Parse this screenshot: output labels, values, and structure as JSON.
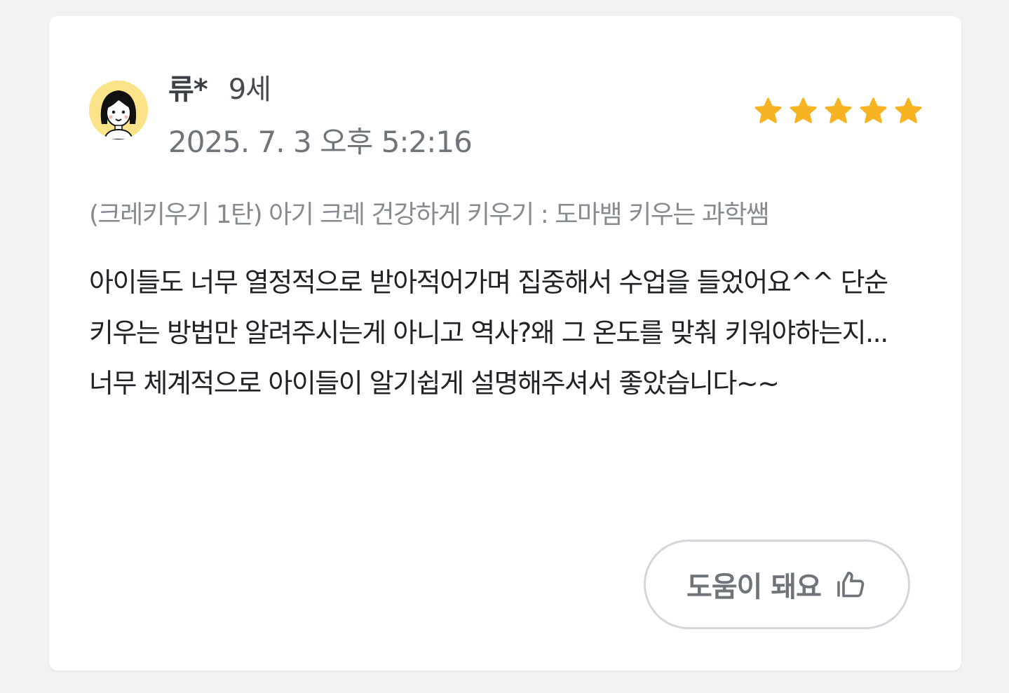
{
  "review": {
    "reviewer_name": "류*",
    "reviewer_age": "9세",
    "timestamp": "2025. 7. 3 오후 5:2:16",
    "rating": 5,
    "rating_max": 5,
    "course_title": "(크레키우기 1탄) 아기 크레 건강하게 키우기 : 도마뱀 키우는 과학쌤",
    "body": "아이들도 너무 열정적으로 받아적어가며 집중해서 수업을 들었어요^^ 단순 키우는 방법만 알려주시는게 아니고 역사?왜 그 온도를 맞춰 키워야하는지... 너무 체계적으로 아이들이 알기쉽게 설명해주셔서 좋았습니다~~"
  },
  "actions": {
    "helpful_label": "도움이 돼요",
    "helpful_icon": "thumbs-up-icon"
  },
  "icons": {
    "avatar": "girl-avatar-icon",
    "star": "star-icon"
  },
  "colors": {
    "star": "#f8b322",
    "avatar_bg": "#fbe38a",
    "button_border": "#d3d7db",
    "page_bg": "#f1f2f4"
  }
}
